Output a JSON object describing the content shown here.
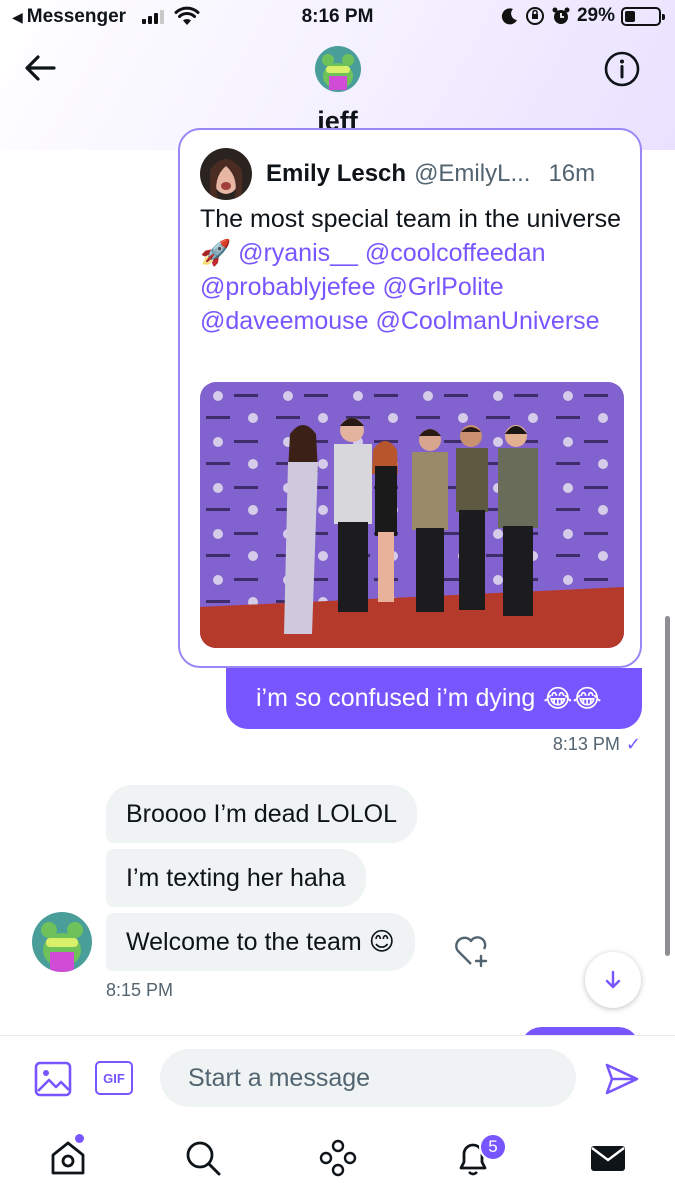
{
  "status_bar": {
    "back_app": "Messenger",
    "time": "8:16 PM",
    "battery": "29%",
    "battery_level": 0.29
  },
  "header": {
    "contact_name": "jeff"
  },
  "tweet": {
    "author": "Emily Lesch",
    "handle": "@EmilyL...",
    "time": "16m",
    "text_prefix": "The most special team in the universe 🚀 ",
    "mentions": [
      "@ryanis__",
      "@coolcoffeedan",
      "@probablyjefee",
      "@GrlPolite",
      "@daveemouse",
      "@CoolmanUniverse"
    ]
  },
  "messages": {
    "sent": {
      "text": "i’m so confused i’m dying",
      "emoji": "😂😂",
      "time": "8:13 PM",
      "status_icon": "checkmark-icon"
    },
    "received": [
      {
        "text": "Broooo I’m dead LOLOL"
      },
      {
        "text": "I’m texting her haha"
      },
      {
        "text": "Welcome to the team 😊"
      }
    ],
    "received_time": "8:15 PM"
  },
  "composer": {
    "gif_label": "GIF",
    "placeholder": "Start a message"
  },
  "tabbar": {
    "notifications_badge": "5",
    "active": "home"
  },
  "colors": {
    "accent": "#7856ff",
    "bubble_received": "#eff3f4",
    "secondary_text": "#536471"
  }
}
